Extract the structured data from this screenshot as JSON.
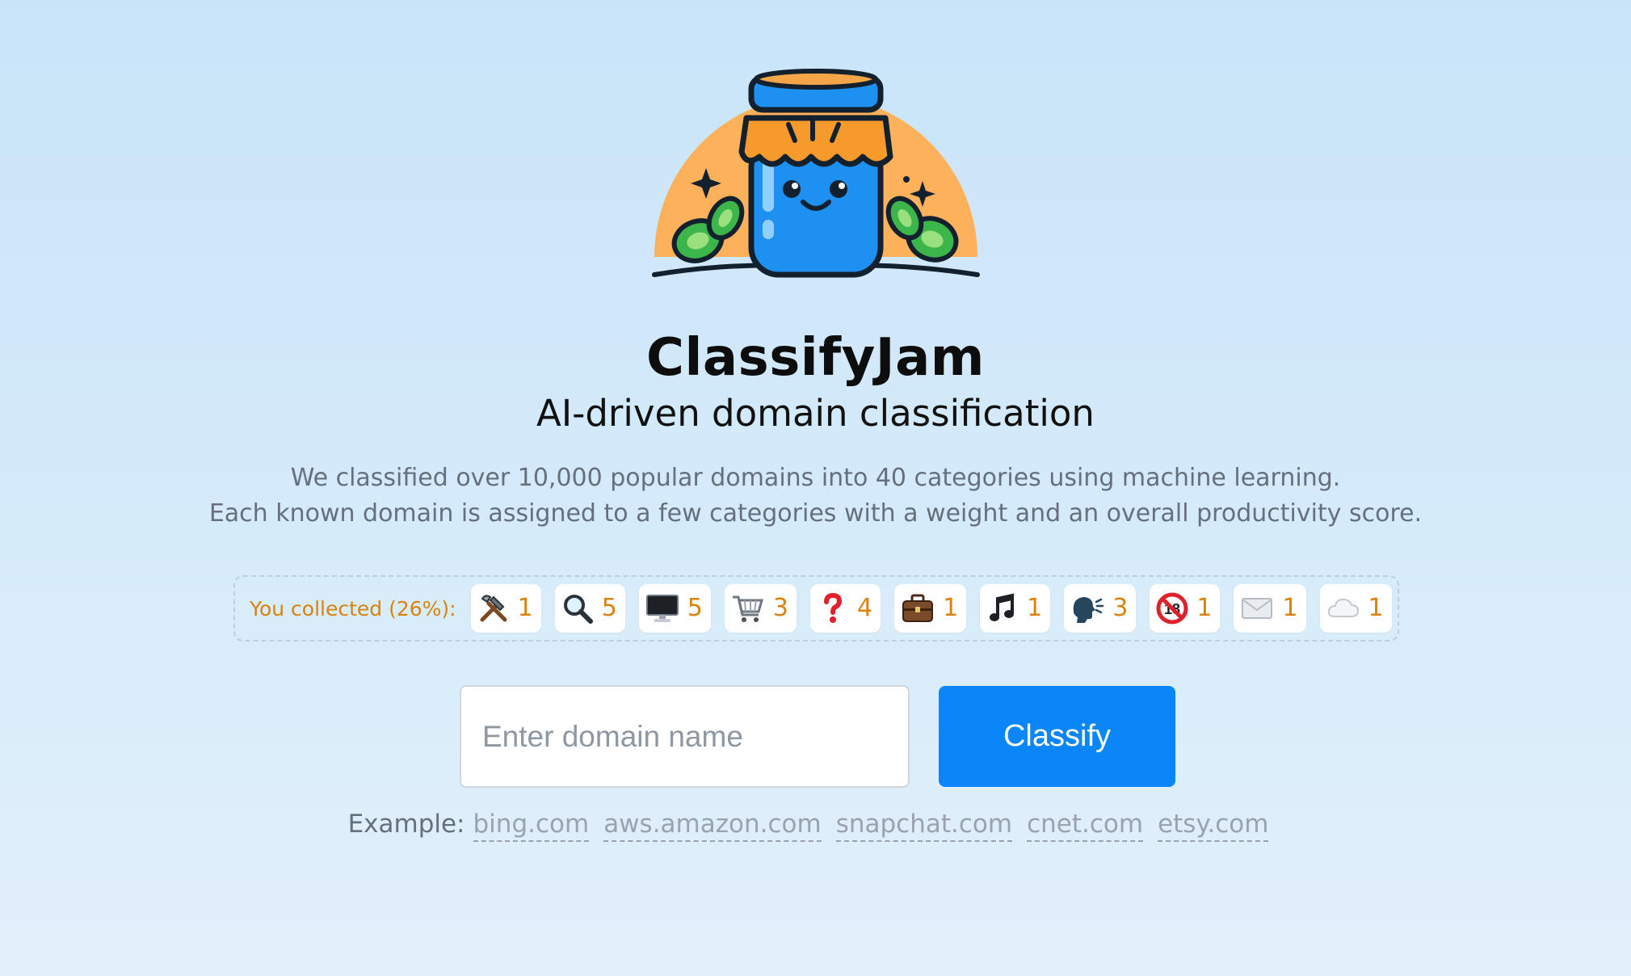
{
  "app": {
    "title": "ClassifyJam",
    "subtitle": "AI-driven domain classification"
  },
  "description": {
    "line1": "We classified over 10,000 popular domains into 40 categories using machine learning.",
    "line2": "Each known domain is assigned to a few categories with a weight and an overall productivity score."
  },
  "collection": {
    "label": "You collected (26%):",
    "percent": 26,
    "badges": [
      {
        "icon": "tools-icon",
        "count": "1"
      },
      {
        "icon": "magnifier-icon",
        "count": "5"
      },
      {
        "icon": "computer-monitor-icon",
        "count": "5"
      },
      {
        "icon": "shopping-cart-icon",
        "count": "3"
      },
      {
        "icon": "question-mark-icon",
        "count": "4"
      },
      {
        "icon": "briefcase-icon",
        "count": "1"
      },
      {
        "icon": "music-note-icon",
        "count": "1"
      },
      {
        "icon": "speaking-head-icon",
        "count": "3"
      },
      {
        "icon": "no-under-18-icon",
        "count": "1"
      },
      {
        "icon": "envelope-icon",
        "count": "1"
      },
      {
        "icon": "cloud-icon",
        "count": "1"
      }
    ]
  },
  "search": {
    "placeholder": "Enter domain name",
    "value": "",
    "button_label": "Classify"
  },
  "examples": {
    "label": "Example:",
    "links": [
      "bing.com",
      "aws.amazon.com",
      "snapchat.com",
      "cnet.com",
      "etsy.com"
    ]
  },
  "colors": {
    "accent": "#0b86f8",
    "collection_text": "#d9830e",
    "logo_orange": "#fdb15a",
    "jar_blue": "#1e90f0",
    "leaf_green": "#3cb54a"
  }
}
